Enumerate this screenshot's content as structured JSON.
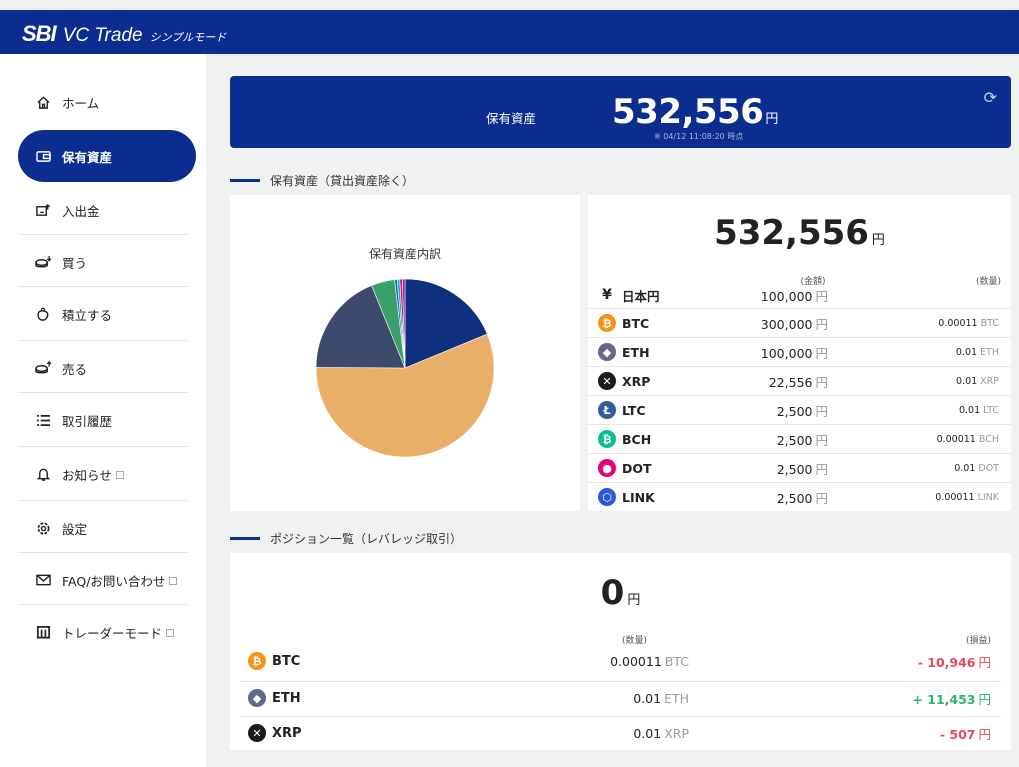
{
  "header": {
    "brand": "SBI",
    "product": "VC Trade",
    "mode": "シンプルモード"
  },
  "sidebar": {
    "items": [
      {
        "label": "ホーム",
        "icon": "home-icon"
      },
      {
        "label": "保有資産",
        "icon": "wallet-icon",
        "active": true
      },
      {
        "label": "入出金",
        "icon": "deposit-icon"
      },
      {
        "label": "買う",
        "icon": "buy-coins-icon"
      },
      {
        "label": "積立する",
        "icon": "piggy-bank-icon"
      },
      {
        "label": "売る",
        "icon": "sell-coins-icon"
      },
      {
        "label": "取引履歴",
        "icon": "list-icon"
      },
      {
        "label": "お知らせ",
        "icon": "bell-icon",
        "external": true
      },
      {
        "label": "設定",
        "icon": "gear-icon"
      },
      {
        "label": "FAQ/お問い合わせ",
        "icon": "mail-icon",
        "external": true
      },
      {
        "label": "トレーダーモード",
        "icon": "building-icon",
        "external": true
      }
    ]
  },
  "banner": {
    "label": "保有資産",
    "value": "532,556",
    "unit": "円",
    "timestamp": "※ 04/12 11:08:20 時点"
  },
  "holdings": {
    "section_title": "保有資産（貸出資産除く）",
    "chart_title": "保有資産内訳",
    "total": "532,556",
    "unit": "円",
    "header_amount": "(金額)",
    "header_qty": "(数量)",
    "rows": [
      {
        "name": "日本円",
        "amount": "100,000",
        "qty": "",
        "qty_unit": "",
        "color": "#222222"
      },
      {
        "name": "BTC",
        "amount": "300,000",
        "qty": "0.00011",
        "qty_unit": "BTC",
        "color": "#f7931a"
      },
      {
        "name": "ETH",
        "amount": "100,000",
        "qty": "0.01",
        "qty_unit": "ETH",
        "color": "#626890"
      },
      {
        "name": "XRP",
        "amount": "22,556",
        "qty": "0.01",
        "qty_unit": "XRP",
        "color": "#23292f"
      },
      {
        "name": "LTC",
        "amount": "2,500",
        "qty": "0.01",
        "qty_unit": "LTC",
        "color": "#345d9d"
      },
      {
        "name": "BCH",
        "amount": "2,500",
        "qty": "0.00011",
        "qty_unit": "BCH",
        "color": "#0ac18e"
      },
      {
        "name": "DOT",
        "amount": "2,500",
        "qty": "0.01",
        "qty_unit": "DOT",
        "color": "#e6007a"
      },
      {
        "name": "LINK",
        "amount": "2,500",
        "qty": "0.00011",
        "qty_unit": "LINK",
        "color": "#2a5ada"
      }
    ]
  },
  "chart_data": {
    "type": "pie",
    "title": "保有資産内訳",
    "categories": [
      "日本円",
      "BTC",
      "ETH",
      "XRP",
      "LTC",
      "BCH",
      "DOT",
      "LINK"
    ],
    "values": [
      100000,
      300000,
      100000,
      22556,
      2500,
      2500,
      2500,
      2500
    ],
    "colors": [
      "#0f2f7f",
      "#e9ae67",
      "#3e4a6c",
      "#3aa06a",
      "#2a5ada",
      "#0ac18e",
      "#e6007a",
      "#7a2a8a"
    ]
  },
  "positions": {
    "section_title": "ポジション一覧（レバレッジ取引）",
    "total": "0",
    "unit": "円",
    "header_qty": "(数量)",
    "header_pl": "(損益)",
    "rows": [
      {
        "name": "BTC",
        "qty": "0.00011",
        "qty_unit": "BTC",
        "pl": "- 10,946",
        "pl_unit": "円",
        "sign": "neg",
        "color": "#f7931a"
      },
      {
        "name": "ETH",
        "qty": "0.01",
        "qty_unit": "ETH",
        "pl": "+ 11,453",
        "pl_unit": "円",
        "sign": "pos",
        "color": "#626890"
      },
      {
        "name": "XRP",
        "qty": "0.01",
        "qty_unit": "XRP",
        "pl": "- 507",
        "pl_unit": "円",
        "sign": "neg",
        "color": "#23292f"
      }
    ]
  }
}
